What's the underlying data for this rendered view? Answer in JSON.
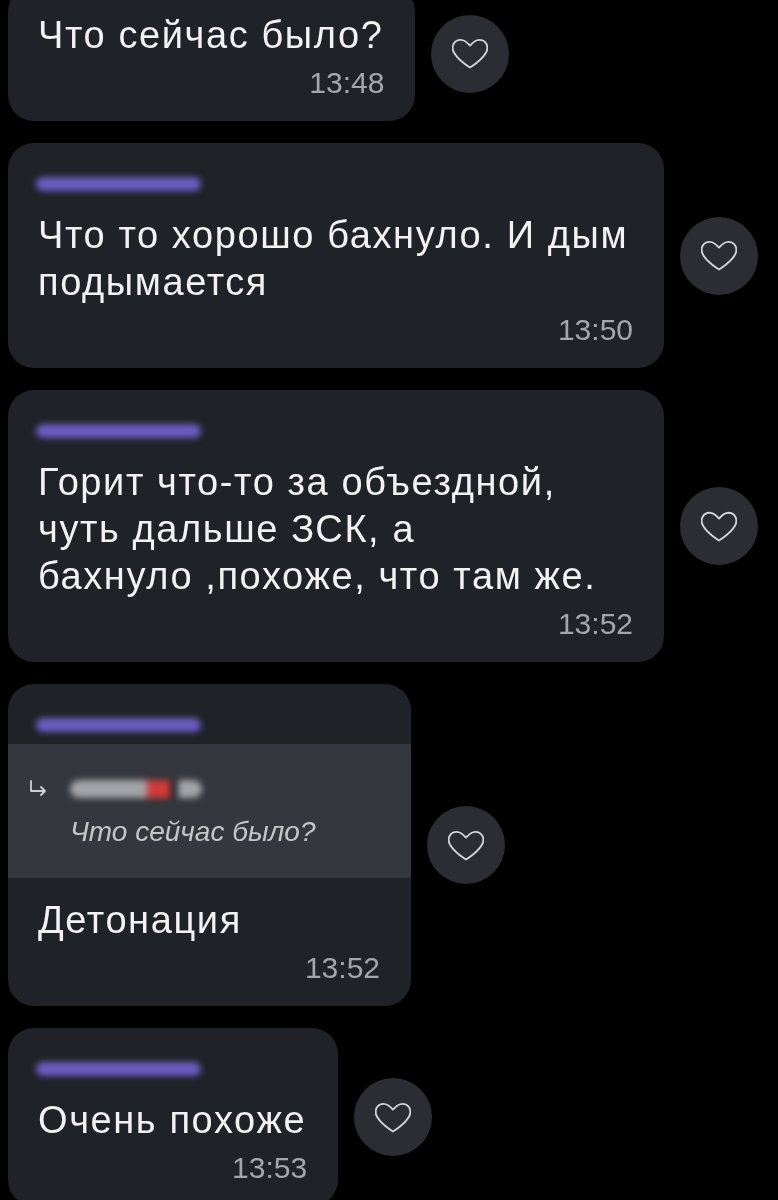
{
  "messages": [
    {
      "text": "Что сейчас было?",
      "time": "13:48",
      "liked": false
    },
    {
      "sender_blurred": true,
      "text": "Что то хорошо бахнуло. И дым подымается",
      "time": "13:50",
      "liked": false
    },
    {
      "sender_blurred": true,
      "text": "Горит что-то за объездной, чуть дальше ЗСК, а\nбахнуло ,похоже, что там же.",
      "time": "13:52",
      "liked": false
    },
    {
      "sender_blurred": true,
      "reply": {
        "author_blurred": true,
        "text": "Что сейчас было?"
      },
      "text": "Детонация",
      "time": "13:52",
      "liked": false
    },
    {
      "sender_blurred": true,
      "text": "Очень похоже",
      "time": "13:53",
      "liked": false
    }
  ]
}
